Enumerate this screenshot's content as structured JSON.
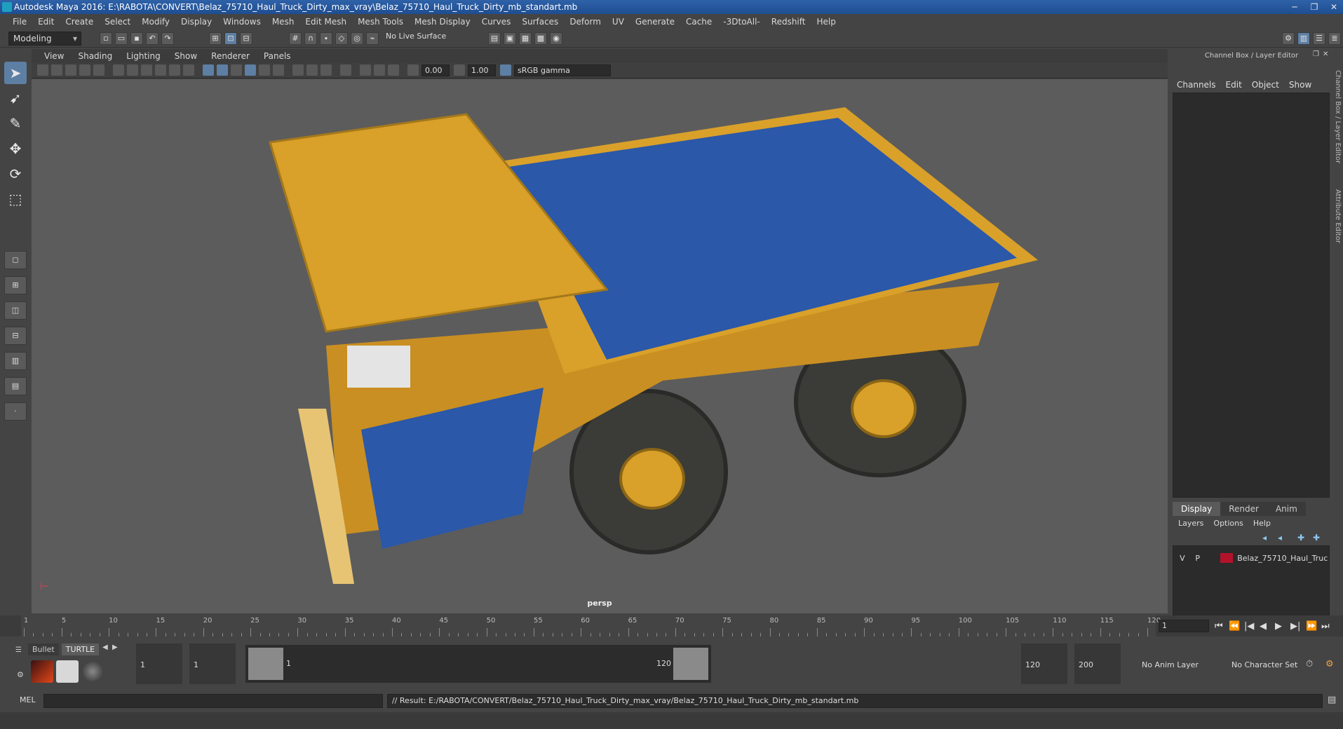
{
  "window": {
    "title": "Autodesk Maya 2016: E:\\RABOTA\\CONVERT\\Belaz_75710_Haul_Truck_Dirty_max_vray\\Belaz_75710_Haul_Truck_Dirty_mb_standart.mb",
    "buttons": {
      "minimize": "─",
      "restore": "❐",
      "close": "✕"
    }
  },
  "menubar": [
    "File",
    "Edit",
    "Create",
    "Select",
    "Modify",
    "Display",
    "Windows",
    "Mesh",
    "Edit Mesh",
    "Mesh Tools",
    "Mesh Display",
    "Curves",
    "Surfaces",
    "Deform",
    "UV",
    "Generate",
    "Cache",
    "-3DtoAll-",
    "Redshift",
    "Help"
  ],
  "statusline": {
    "mode": "Modeling",
    "live_surface": "No Live Surface"
  },
  "panel_menu": [
    "View",
    "Shading",
    "Lighting",
    "Show",
    "Renderer",
    "Panels"
  ],
  "panel_toolbar": {
    "exposure": "0.00",
    "gamma": "1.00",
    "color_space": "sRGB gamma"
  },
  "viewport": {
    "camera": "persp",
    "truck_number": "75710",
    "colors": {
      "body": "#d9a02a",
      "bed": "#2b58a8",
      "tire": "#3b3b37",
      "rim": "#d9a02a",
      "background": "#5c5c5c"
    }
  },
  "channel_box": {
    "title": "Channel Box / Layer Editor",
    "menu": [
      "Channels",
      "Edit",
      "Object",
      "Show"
    ],
    "side_tabs": [
      "Channel Box / Layer Editor",
      "Attribute Editor"
    ]
  },
  "layer_editor": {
    "tabs": [
      "Display",
      "Render",
      "Anim"
    ],
    "menu": [
      "Layers",
      "Options",
      "Help"
    ],
    "layer": {
      "v": "V",
      "p": "P",
      "name": "Belaz_75710_Haul_Truck_",
      "color": "#b3122b"
    }
  },
  "timeline": {
    "ticks": [
      "1",
      "5",
      "10",
      "15",
      "20",
      "25",
      "30",
      "35",
      "40",
      "45",
      "50",
      "55",
      "60",
      "65",
      "70",
      "75",
      "80",
      "85",
      "90",
      "95",
      "100",
      "105",
      "110",
      "115",
      "120"
    ],
    "current_frame": "1",
    "playback": [
      "⏮",
      "⏪",
      "|◀",
      "◀",
      "▶",
      "▶|",
      "⏩",
      "⏭"
    ]
  },
  "shelf": {
    "tabs": [
      "Bullet",
      "TURTLE"
    ]
  },
  "range": {
    "start": "1",
    "playback_start": "1",
    "slider_start": "1",
    "slider_end": "120",
    "playback_end": "120",
    "end": "200",
    "anim_layer": "No Anim Layer",
    "character_set": "No Character Set"
  },
  "command_line": {
    "label": "MEL",
    "result": "// Result: E:/RABOTA/CONVERT/Belaz_75710_Haul_Truck_Dirty_max_vray/Belaz_75710_Haul_Truck_Dirty_mb_standart.mb"
  }
}
